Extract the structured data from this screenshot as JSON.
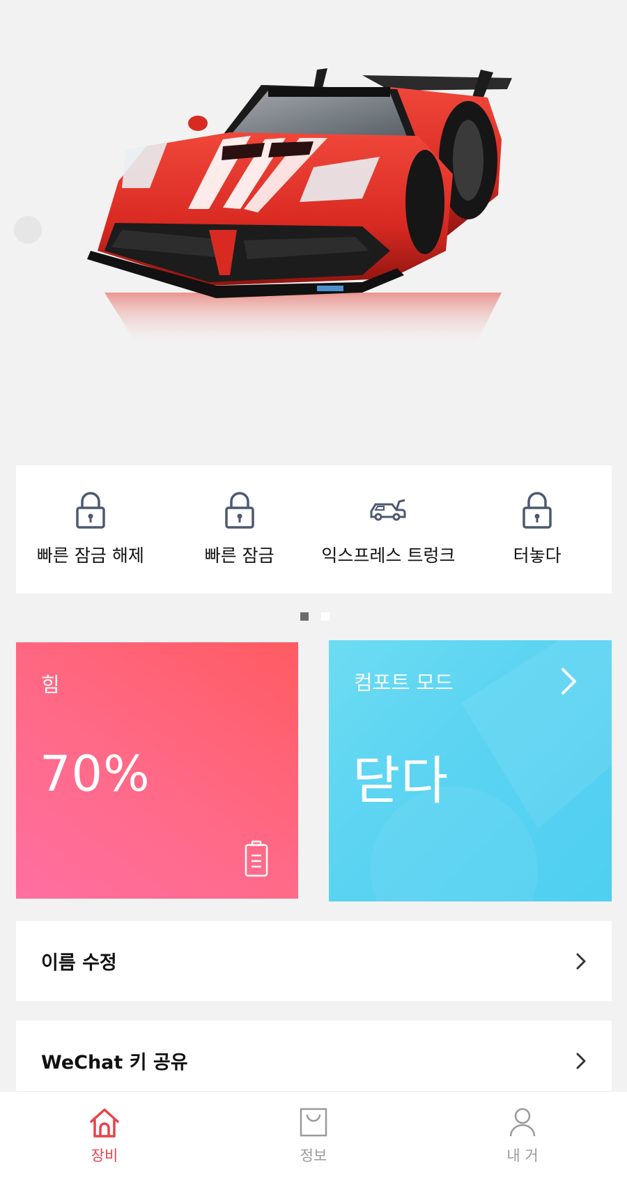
{
  "quick_actions": [
    {
      "label": "빠른 잠금 해제",
      "icon": "lock-icon"
    },
    {
      "label": "빠른 잠금",
      "icon": "lock-icon"
    },
    {
      "label": "익스프레스 트렁크",
      "icon": "car-trunk-icon"
    },
    {
      "label": "터놓다",
      "icon": "lock-icon"
    }
  ],
  "pager": {
    "pages": 2,
    "active": 1
  },
  "power_card": {
    "title": "힘",
    "value": "70%",
    "icon": "battery-icon"
  },
  "comfort_card": {
    "title": "컴포트 모드",
    "value": "닫다",
    "icon": "chevron-right-icon"
  },
  "settings": [
    {
      "label": "이름 수정"
    },
    {
      "label": "WeChat 키 공유"
    }
  ],
  "tabbar": [
    {
      "label": "장비",
      "icon": "home-icon",
      "active": true
    },
    {
      "label": "정보",
      "icon": "bag-icon",
      "active": false
    },
    {
      "label": "내 거",
      "icon": "user-icon",
      "active": false
    }
  ],
  "colors": {
    "accent": "#e94248",
    "power_card_start": "#ff6fa1",
    "power_card_end": "#ff5b62",
    "comfort_card": "#56d3f2",
    "icon_gray": "#4d5870"
  }
}
